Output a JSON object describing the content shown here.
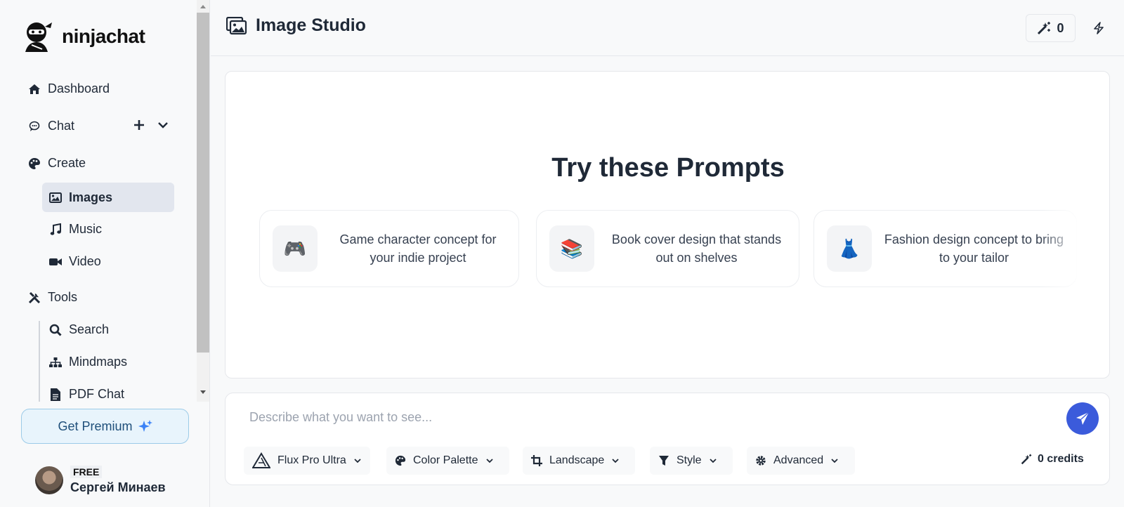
{
  "app": {
    "logo_text": "ninjachat"
  },
  "sidebar": {
    "items": [
      {
        "label": "Dashboard",
        "icon": "home-icon"
      },
      {
        "label": "Chat",
        "icon": "chat-bubble-icon"
      },
      {
        "label": "Create",
        "icon": "palette-icon"
      },
      {
        "label": "Images",
        "icon": "image-icon",
        "active": true
      },
      {
        "label": "Music",
        "icon": "music-note-icon"
      },
      {
        "label": "Video",
        "icon": "video-camera-icon"
      },
      {
        "label": "Tools",
        "icon": "tools-icon"
      },
      {
        "label": "Search",
        "icon": "search-icon"
      },
      {
        "label": "Mindmaps",
        "icon": "sitemap-icon"
      },
      {
        "label": "PDF Chat",
        "icon": "file-icon"
      }
    ],
    "premium_label": "Get Premium",
    "user": {
      "plan": "FREE",
      "name": "Сергей Минаев"
    }
  },
  "header": {
    "title": "Image Studio",
    "credit_count": "0"
  },
  "main": {
    "heading": "Try these Prompts",
    "prompts": [
      {
        "emoji": "🎮",
        "text": "Game character concept for your indie project"
      },
      {
        "emoji": "📚",
        "text": "Book cover design that stands out on shelves"
      },
      {
        "emoji": "👗",
        "text": "Fashion design concept to bring to your tailor"
      }
    ]
  },
  "composer": {
    "placeholder": "Describe what you want to see...",
    "options": {
      "model": "Flux Pro Ultra",
      "palette": "Color Palette",
      "orientation": "Landscape",
      "style": "Style",
      "advanced": "Advanced"
    },
    "credits": "0 credits"
  },
  "colors": {
    "accent": "#3b5bdb",
    "premium_bg": "#e8f4fc",
    "active_bg": "#e2e6ee"
  }
}
